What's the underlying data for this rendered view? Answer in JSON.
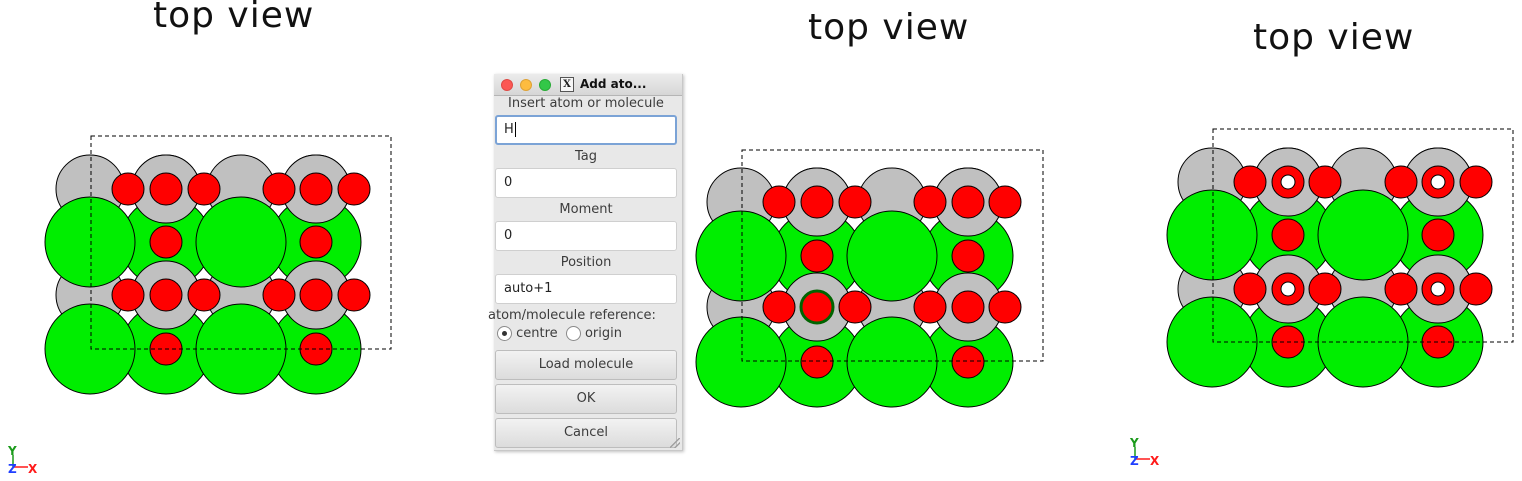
{
  "panels": {
    "left_title": "top view",
    "middle_title": "top view",
    "right_title": "top view"
  },
  "axes": {
    "y_label": "Y",
    "z_label": "Z",
    "x_label": "X",
    "y_color": "#1a9a1a",
    "z_color": "#1f3fff",
    "x_color": "#ff1a1a"
  },
  "colors": {
    "metal_green": "#00ee00",
    "oxygen_red": "#ff0000",
    "grey_atom": "#c0c0c0",
    "added_atom_outline": "#006400"
  },
  "dialog": {
    "title": "Add ato...",
    "close_icon": "close-dot",
    "minimize_icon": "minimize-dot",
    "maximize_icon": "maximize-dot",
    "x11_icon": "X",
    "insert_label": "Insert atom or molecule",
    "insert_value": "H",
    "tag_label": "Tag",
    "tag_value": "0",
    "moment_label": "Moment",
    "moment_value": "0",
    "position_label": "Position",
    "position_value": "auto+1",
    "reference_label": "atom/molecule reference:",
    "radio_centre": "centre",
    "radio_origin": "origin",
    "selected_reference": "centre",
    "load_molecule": "Load molecule",
    "ok": "OK",
    "cancel": "Cancel"
  }
}
